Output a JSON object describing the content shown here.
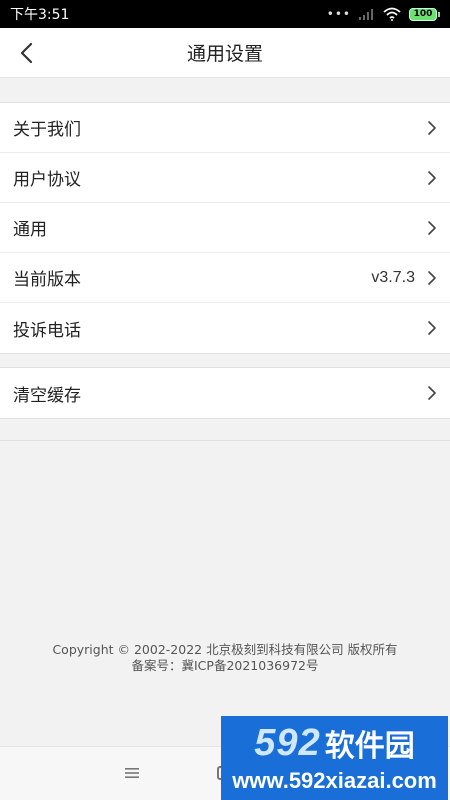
{
  "status_bar": {
    "time": "下午3:51",
    "battery": "100"
  },
  "header": {
    "title": "通用设置"
  },
  "group1": {
    "items": [
      {
        "label": "关于我们"
      },
      {
        "label": "用户协议"
      },
      {
        "label": "通用"
      },
      {
        "label": "当前版本",
        "value": "v3.7.3"
      },
      {
        "label": "投诉电话"
      }
    ]
  },
  "group2": {
    "items": [
      {
        "label": "清空缓存"
      }
    ]
  },
  "footer": {
    "copyright": "Copyright © 2002-2022 北京极刻到科技有限公司 版权所有",
    "icp": "备案号：冀ICP备2021036972号"
  },
  "watermark": {
    "number": "592",
    "text": "软件园",
    "url": "www.592xiazai.com"
  },
  "colors": {
    "accent": "#1a6ed8",
    "battery": "#6fe06f"
  }
}
